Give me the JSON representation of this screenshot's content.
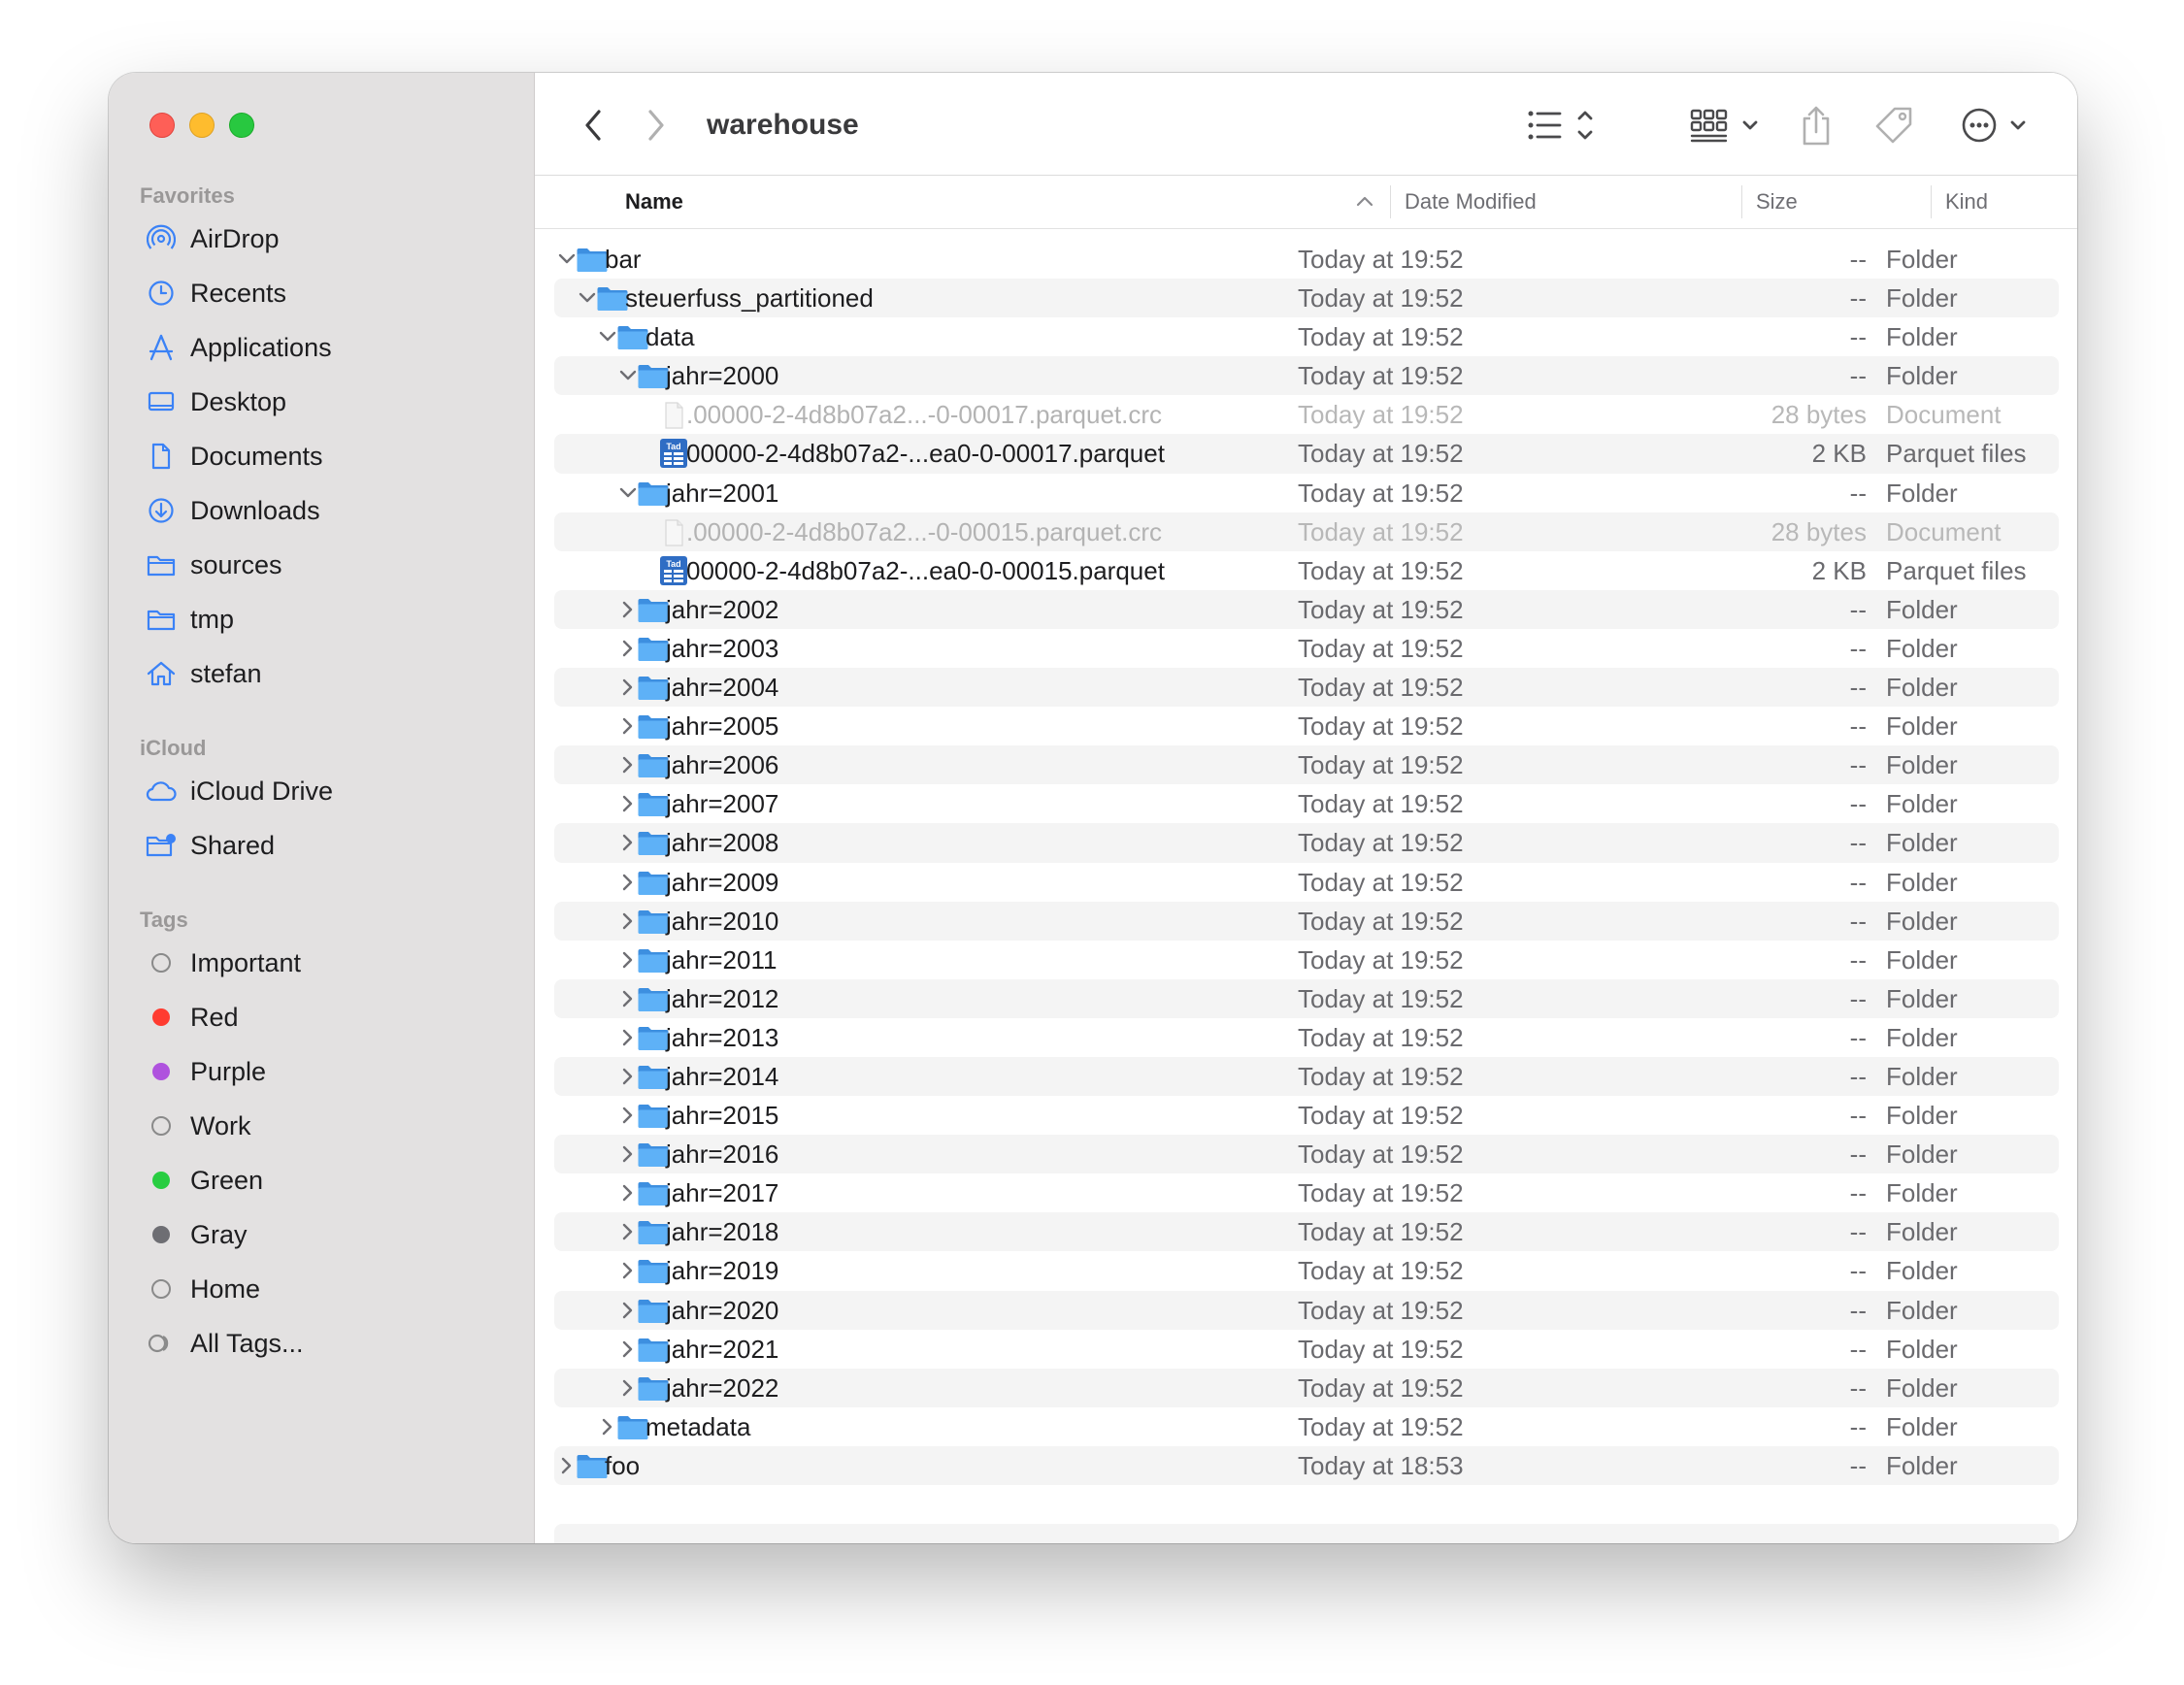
{
  "window": {
    "title": "warehouse"
  },
  "sidebar": {
    "favorites_label": "Favorites",
    "favorites": [
      {
        "label": "AirDrop",
        "icon": "airdrop-icon"
      },
      {
        "label": "Recents",
        "icon": "clock-icon"
      },
      {
        "label": "Applications",
        "icon": "applications-icon"
      },
      {
        "label": "Desktop",
        "icon": "desktop-icon"
      },
      {
        "label": "Documents",
        "icon": "document-icon"
      },
      {
        "label": "Downloads",
        "icon": "download-icon"
      },
      {
        "label": "sources",
        "icon": "folder-icon"
      },
      {
        "label": "tmp",
        "icon": "folder-icon"
      },
      {
        "label": "stefan",
        "icon": "home-icon"
      }
    ],
    "icloud_label": "iCloud",
    "icloud": [
      {
        "label": "iCloud Drive",
        "icon": "cloud-icon"
      },
      {
        "label": "Shared",
        "icon": "shared-folder-icon"
      }
    ],
    "tags_label": "Tags",
    "tags": [
      {
        "label": "Important",
        "color": ""
      },
      {
        "label": "Red",
        "color": "#ff3b30"
      },
      {
        "label": "Purple",
        "color": "#af52de"
      },
      {
        "label": "Work",
        "color": ""
      },
      {
        "label": "Green",
        "color": "#28cd41"
      },
      {
        "label": "Gray",
        "color": "#6e6e73"
      },
      {
        "label": "Home",
        "color": ""
      },
      {
        "label": "All Tags...",
        "color": "all"
      }
    ]
  },
  "columns": {
    "name": "Name",
    "date": "Date Modified",
    "size": "Size",
    "kind": "Kind"
  },
  "rows": [
    {
      "name": "bar",
      "date": "Today at 19:52",
      "size": "--",
      "kind": "Folder",
      "level": 0,
      "type": "folder",
      "expanded": true
    },
    {
      "name": "steuerfuss_partitioned",
      "date": "Today at 19:52",
      "size": "--",
      "kind": "Folder",
      "level": 1,
      "type": "folder",
      "expanded": true
    },
    {
      "name": "data",
      "date": "Today at 19:52",
      "size": "--",
      "kind": "Folder",
      "level": 2,
      "type": "folder",
      "expanded": true
    },
    {
      "name": "jahr=2000",
      "date": "Today at 19:52",
      "size": "--",
      "kind": "Folder",
      "level": 3,
      "type": "folder",
      "expanded": true
    },
    {
      "name": ".00000-2-4d8b07a2...-0-00017.parquet.crc",
      "date": "Today at 19:52",
      "size": "28 bytes",
      "kind": "Document",
      "level": 4,
      "type": "doc",
      "dim": true
    },
    {
      "name": "00000-2-4d8b07a2-...ea0-0-00017.parquet",
      "date": "Today at 19:52",
      "size": "2 KB",
      "kind": "Parquet files",
      "level": 4,
      "type": "parquet"
    },
    {
      "name": "jahr=2001",
      "date": "Today at 19:52",
      "size": "--",
      "kind": "Folder",
      "level": 3,
      "type": "folder",
      "expanded": true
    },
    {
      "name": ".00000-2-4d8b07a2...-0-00015.parquet.crc",
      "date": "Today at 19:52",
      "size": "28 bytes",
      "kind": "Document",
      "level": 4,
      "type": "doc",
      "dim": true
    },
    {
      "name": "00000-2-4d8b07a2-...ea0-0-00015.parquet",
      "date": "Today at 19:52",
      "size": "2 KB",
      "kind": "Parquet files",
      "level": 4,
      "type": "parquet"
    },
    {
      "name": "jahr=2002",
      "date": "Today at 19:52",
      "size": "--",
      "kind": "Folder",
      "level": 3,
      "type": "folder",
      "expanded": false
    },
    {
      "name": "jahr=2003",
      "date": "Today at 19:52",
      "size": "--",
      "kind": "Folder",
      "level": 3,
      "type": "folder",
      "expanded": false
    },
    {
      "name": "jahr=2004",
      "date": "Today at 19:52",
      "size": "--",
      "kind": "Folder",
      "level": 3,
      "type": "folder",
      "expanded": false
    },
    {
      "name": "jahr=2005",
      "date": "Today at 19:52",
      "size": "--",
      "kind": "Folder",
      "level": 3,
      "type": "folder",
      "expanded": false
    },
    {
      "name": "jahr=2006",
      "date": "Today at 19:52",
      "size": "--",
      "kind": "Folder",
      "level": 3,
      "type": "folder",
      "expanded": false
    },
    {
      "name": "jahr=2007",
      "date": "Today at 19:52",
      "size": "--",
      "kind": "Folder",
      "level": 3,
      "type": "folder",
      "expanded": false
    },
    {
      "name": "jahr=2008",
      "date": "Today at 19:52",
      "size": "--",
      "kind": "Folder",
      "level": 3,
      "type": "folder",
      "expanded": false
    },
    {
      "name": "jahr=2009",
      "date": "Today at 19:52",
      "size": "--",
      "kind": "Folder",
      "level": 3,
      "type": "folder",
      "expanded": false
    },
    {
      "name": "jahr=2010",
      "date": "Today at 19:52",
      "size": "--",
      "kind": "Folder",
      "level": 3,
      "type": "folder",
      "expanded": false
    },
    {
      "name": "jahr=2011",
      "date": "Today at 19:52",
      "size": "--",
      "kind": "Folder",
      "level": 3,
      "type": "folder",
      "expanded": false
    },
    {
      "name": "jahr=2012",
      "date": "Today at 19:52",
      "size": "--",
      "kind": "Folder",
      "level": 3,
      "type": "folder",
      "expanded": false
    },
    {
      "name": "jahr=2013",
      "date": "Today at 19:52",
      "size": "--",
      "kind": "Folder",
      "level": 3,
      "type": "folder",
      "expanded": false
    },
    {
      "name": "jahr=2014",
      "date": "Today at 19:52",
      "size": "--",
      "kind": "Folder",
      "level": 3,
      "type": "folder",
      "expanded": false
    },
    {
      "name": "jahr=2015",
      "date": "Today at 19:52",
      "size": "--",
      "kind": "Folder",
      "level": 3,
      "type": "folder",
      "expanded": false
    },
    {
      "name": "jahr=2016",
      "date": "Today at 19:52",
      "size": "--",
      "kind": "Folder",
      "level": 3,
      "type": "folder",
      "expanded": false
    },
    {
      "name": "jahr=2017",
      "date": "Today at 19:52",
      "size": "--",
      "kind": "Folder",
      "level": 3,
      "type": "folder",
      "expanded": false
    },
    {
      "name": "jahr=2018",
      "date": "Today at 19:52",
      "size": "--",
      "kind": "Folder",
      "level": 3,
      "type": "folder",
      "expanded": false
    },
    {
      "name": "jahr=2019",
      "date": "Today at 19:52",
      "size": "--",
      "kind": "Folder",
      "level": 3,
      "type": "folder",
      "expanded": false
    },
    {
      "name": "jahr=2020",
      "date": "Today at 19:52",
      "size": "--",
      "kind": "Folder",
      "level": 3,
      "type": "folder",
      "expanded": false
    },
    {
      "name": "jahr=2021",
      "date": "Today at 19:52",
      "size": "--",
      "kind": "Folder",
      "level": 3,
      "type": "folder",
      "expanded": false
    },
    {
      "name": "jahr=2022",
      "date": "Today at 19:52",
      "size": "--",
      "kind": "Folder",
      "level": 3,
      "type": "folder",
      "expanded": false
    },
    {
      "name": "metadata",
      "date": "Today at 19:52",
      "size": "--",
      "kind": "Folder",
      "level": 2,
      "type": "folder",
      "expanded": false
    },
    {
      "name": "foo",
      "date": "Today at 18:53",
      "size": "--",
      "kind": "Folder",
      "level": 0,
      "type": "folder",
      "expanded": false
    }
  ],
  "colors": {
    "accent": "#007aff",
    "folder_blue": "#5aaef5"
  }
}
